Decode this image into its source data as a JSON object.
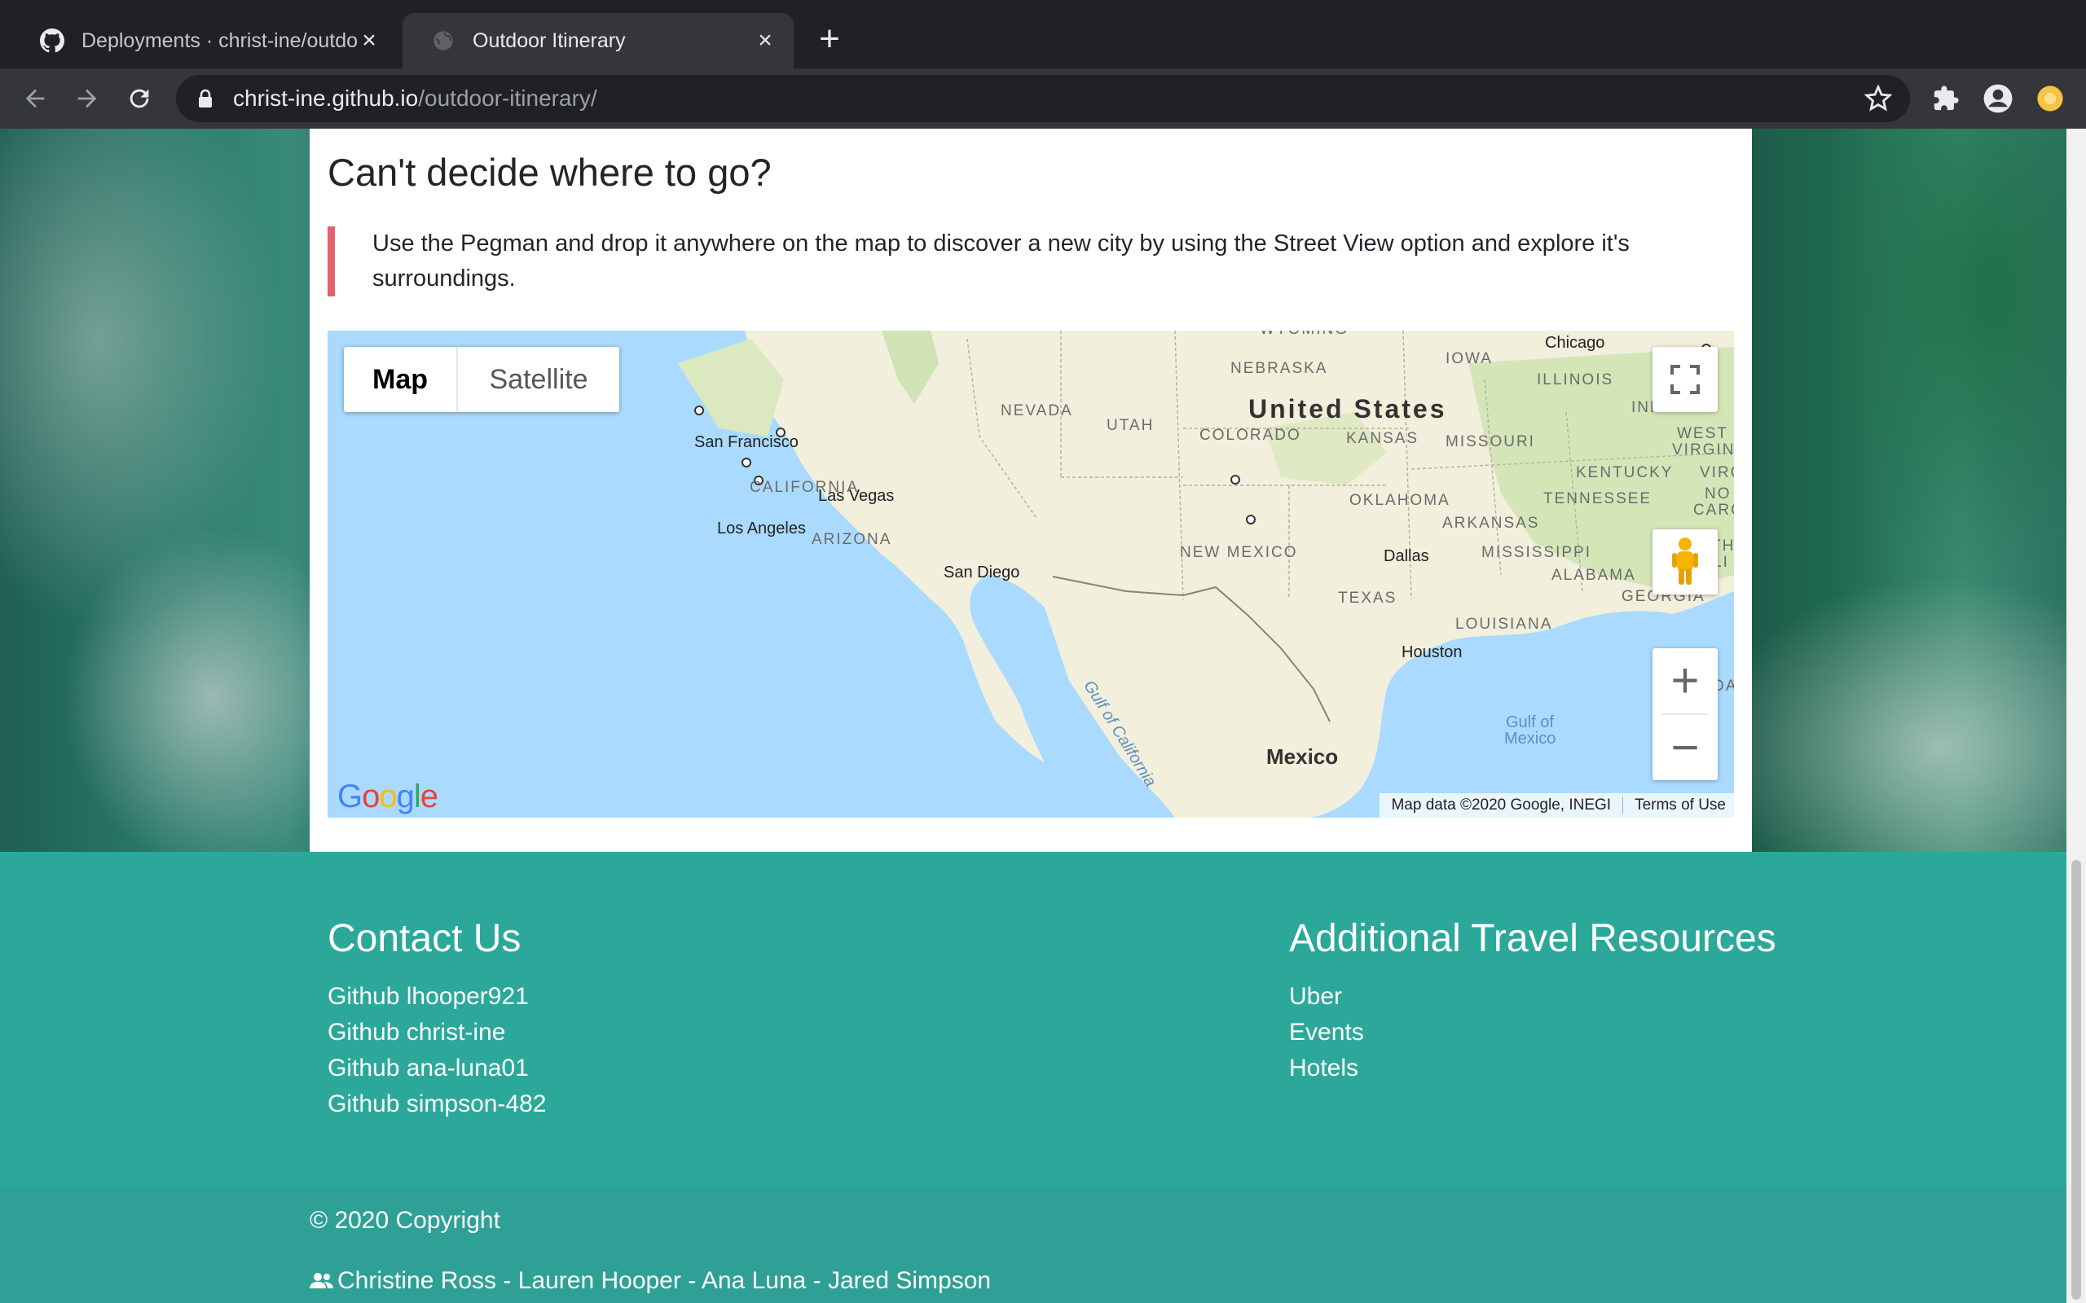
{
  "browser": {
    "tabs": [
      {
        "title": "Deployments · christ-ine/outdoor-itinerary",
        "favicon": "github-icon",
        "active": false
      },
      {
        "title": "Outdoor Itinerary",
        "favicon": "globe-icon",
        "active": true
      }
    ],
    "new_tab_label": "+",
    "close_label": "×",
    "url_host": "christ-ine.github.io",
    "url_path": "/outdoor-itinerary/"
  },
  "main": {
    "section_title": "Can't decide where to go?",
    "quote": "Use the Pegman and drop it anywhere on the map to discover a new city by using the Street View option and explore it's surroundings."
  },
  "map": {
    "map_type_map": "Map",
    "map_type_satellite": "Satellite",
    "zoom_in": "+",
    "zoom_out": "−",
    "attribution": "Map data ©2020 Google, INEGI",
    "terms": "Terms of Use",
    "labels": {
      "country_us": "United States",
      "country_mx": "Mexico",
      "wyoming": "WYOMING",
      "nebraska": "NEBRASKA",
      "iowa": "IOWA",
      "illinois": "ILLINOIS",
      "indiana": "INDIANA",
      "nevada": "NEVADA",
      "utah": "UTAH",
      "colorado": "COLORADO",
      "kansas": "KANSAS",
      "missouri": "MISSOURI",
      "west_virginia_1": "WEST",
      "west_virginia_2": "VIRGINI",
      "kentucky": "KENTUCKY",
      "virginia": "VIRG",
      "california": "CALIFORNIA",
      "oklahoma": "OKLAHOMA",
      "tennessee": "TENNESSEE",
      "north_carolina_1": "NO",
      "north_carolina_2": "CARO",
      "arkansas": "ARKANSAS",
      "arizona": "ARIZONA",
      "new_mexico": "NEW MEXICO",
      "mississippi": "MISSISSIPPI",
      "alabama": "ALABAMA",
      "georgia": "GEORGIA",
      "texas": "TEXAS",
      "louisiana": "LOUISIANA",
      "south_1": "TH",
      "south_2": "LI",
      "florida": "DA",
      "chicago": "Chicago",
      "san_francisco": "San Francisco",
      "las_vegas": "Las Vegas",
      "los_angeles": "Los Angeles",
      "san_diego": "San Diego",
      "dallas": "Dallas",
      "houston": "Houston",
      "gulf_california": "Gulf of California",
      "gulf_mexico_1": "Gulf of",
      "gulf_mexico_2": "Mexico"
    }
  },
  "footer": {
    "contact_heading": "Contact Us",
    "contact_links": [
      "Github lhooper921",
      "Github christ-ine",
      "Github ana-luna01",
      "Github simpson-482"
    ],
    "resources_heading": "Additional Travel Resources",
    "resource_links": [
      "Uber",
      "Events",
      "Hotels"
    ],
    "copyright": "© 2020 Copyright",
    "credits": "Christine Ross - Lauren Hooper - Ana Luna - Jared Simpson"
  },
  "colors": {
    "accent_quote_border": "#e2636b",
    "footer_main": "#2ba89a",
    "footer_bottom": "#2fa095",
    "map_water": "#aadaff",
    "map_land": "#f2efdc"
  }
}
